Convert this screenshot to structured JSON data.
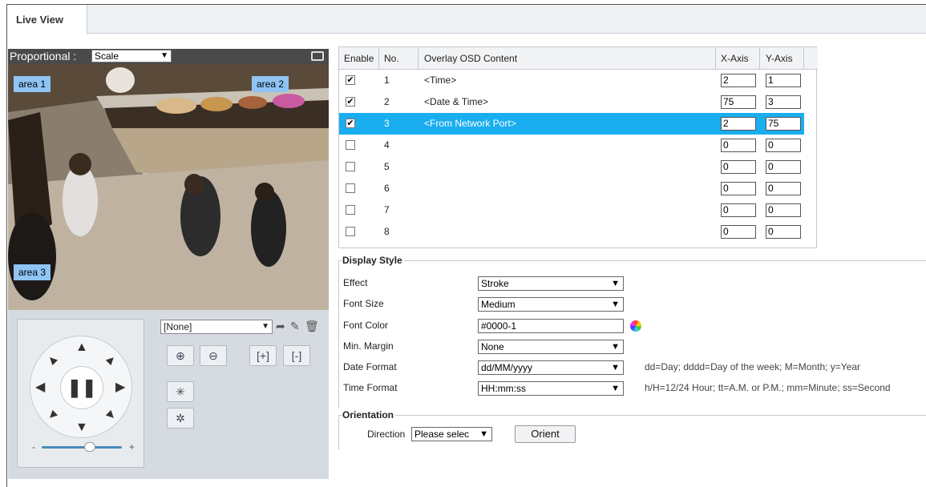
{
  "tabs": {
    "live_view": "Live View"
  },
  "video": {
    "proportional_label": "Proportional :",
    "scale_value": "Scale",
    "areas": [
      "area 1",
      "area 2",
      "area 3"
    ]
  },
  "ptz": {
    "preset_value": "[None]",
    "pause_glyph": "❚❚",
    "slider_min": "-",
    "slider_max": "+",
    "zoom_level": 0.6
  },
  "osd": {
    "headers": {
      "enable": "Enable",
      "no": "No.",
      "content": "Overlay OSD Content",
      "x": "X-Axis",
      "y": "Y-Axis"
    },
    "rows": [
      {
        "checked": true,
        "no": "1",
        "content": "<Time>",
        "x": "2",
        "y": "1"
      },
      {
        "checked": true,
        "no": "2",
        "content": "<Date & Time>",
        "x": "75",
        "y": "3"
      },
      {
        "checked": true,
        "no": "3",
        "content": "<From Network Port>",
        "x": "2",
        "y": "75",
        "selected": true
      },
      {
        "checked": false,
        "no": "4",
        "content": "",
        "x": "0",
        "y": "0"
      },
      {
        "checked": false,
        "no": "5",
        "content": "",
        "x": "0",
        "y": "0"
      },
      {
        "checked": false,
        "no": "6",
        "content": "",
        "x": "0",
        "y": "0"
      },
      {
        "checked": false,
        "no": "7",
        "content": "",
        "x": "0",
        "y": "0"
      },
      {
        "checked": false,
        "no": "8",
        "content": "",
        "x": "0",
        "y": "0"
      }
    ]
  },
  "display_style": {
    "legend": "Display Style",
    "effect_label": "Effect",
    "effect_value": "Stroke",
    "font_size_label": "Font Size",
    "font_size_value": "Medium",
    "font_color_label": "Font Color",
    "font_color_value": "#0000-1",
    "min_margin_label": "Min. Margin",
    "min_margin_value": "None",
    "date_format_label": "Date Format",
    "date_format_value": "dd/MM/yyyy",
    "date_hint": "dd=Day; dddd=Day of the week; M=Month; y=Year",
    "time_format_label": "Time Format",
    "time_format_value": "HH:mm:ss",
    "time_hint": "h/H=12/24 Hour; tt=A.M. or P.M.; mm=Minute; ss=Second"
  },
  "orientation": {
    "legend": "Orientation",
    "direction_label": "Direction",
    "direction_value": "Please selec",
    "orient_button": "Orient"
  },
  "colors": {
    "selected_row": "#1aaef0",
    "area_label": "#8fc4f4",
    "panel_bg": "#d6dbe1"
  }
}
